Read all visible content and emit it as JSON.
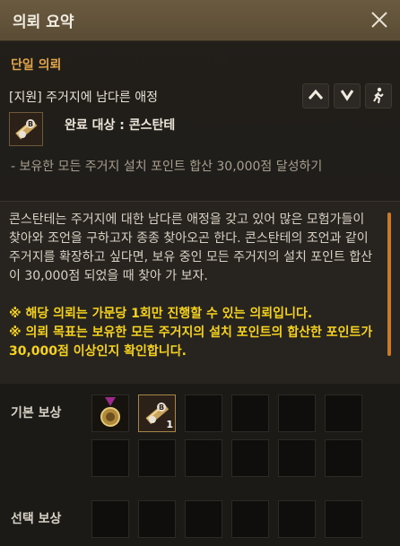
{
  "window": {
    "title": "의뢰 요약"
  },
  "quest": {
    "section_title": "단일 의뢰",
    "name": "[지원] 주거지에 남다른 애정",
    "target_label": "완료 대상 : 콘스탄테",
    "goal": "- 보유한 모든 주거지 설치 포인트 합산 30,000점 달성하기",
    "description": "콘스탄테는 주거지에 대한 남다른 애정을 갖고 있어 많은 모험가들이 찾아와 조언을 구하고자 종종 찾아오곤 한다. 콘스탄테의 조언과 같이 주거지를 확장하고 싶다면, 보유 중인 모든 주거지의 설치 포인트 합산이 30,000점 되었을 때 찾아 가 보자.",
    "notice_1": "※ 해당 의뢰는 가문당 1회만 진행할 수 있는 의뢰입니다.",
    "notice_2": "※ 의뢰 목표는 보유한 모든 주거지의 설치 포인트의 합산한 포인트가 30,000점 이상인지 확인합니다."
  },
  "buttons": {
    "expand_icon": "chevron-up-icon",
    "collapse_icon": "chevron-down-icon",
    "navigate_icon": "walking-person-icon"
  },
  "rewards": {
    "basic_label": "기본 보상",
    "select_label": "선택 보상",
    "basic_items": [
      {
        "icon": "medal-icon",
        "count": ""
      },
      {
        "icon": "scroll-icon",
        "count": "1"
      }
    ]
  },
  "colors": {
    "title_bar": "#5f5039",
    "section_title": "#e2a54a",
    "notice": "#f5d21e",
    "scrollbar": "#c97a2a"
  }
}
